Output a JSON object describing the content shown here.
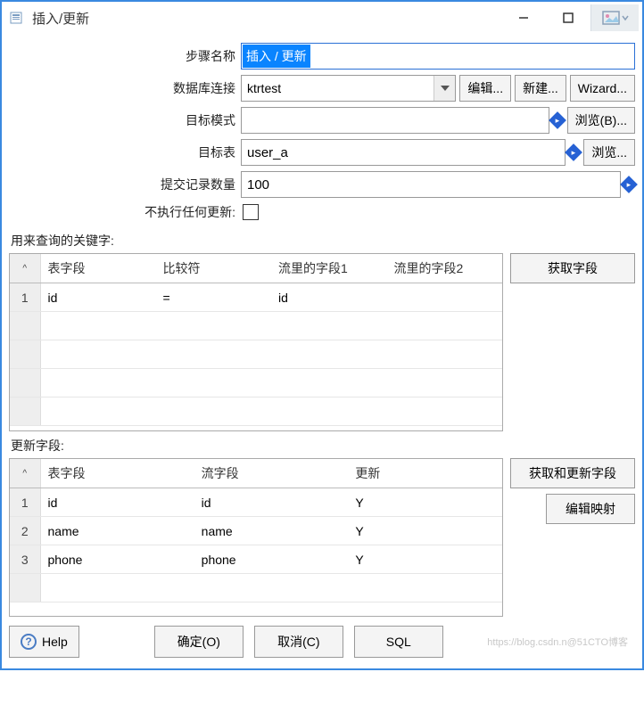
{
  "window": {
    "title": "插入/更新"
  },
  "form": {
    "step_name_label": "步骤名称",
    "step_name_value": "插入 / 更新",
    "db_conn_label": "数据库连接",
    "db_conn_value": "ktrtest",
    "edit_btn": "编辑...",
    "new_btn": "新建...",
    "wizard_btn": "Wizard...",
    "target_schema_label": "目标模式",
    "target_schema_value": "",
    "browse_b_btn": "浏览(B)...",
    "target_table_label": "目标表",
    "target_table_value": "user_a",
    "browse_btn": "浏览...",
    "commit_count_label": "提交记录数量",
    "commit_count_value": "100",
    "no_update_label": "不执行任何更新:"
  },
  "lookup": {
    "section_label": "用来查询的关键字:",
    "get_fields_btn": "获取字段",
    "headers": {
      "num": "#",
      "table_field": "表字段",
      "comparator": "比较符",
      "stream_field1": "流里的字段1",
      "stream_field2": "流里的字段2"
    },
    "rows": [
      {
        "num": "1",
        "table_field": "id",
        "comparator": "=",
        "stream_field1": "id",
        "stream_field2": ""
      }
    ]
  },
  "update": {
    "section_label": "更新字段:",
    "get_update_btn": "获取和更新字段",
    "edit_mapping_btn": "编辑映射",
    "headers": {
      "num": "#",
      "table_field": "表字段",
      "stream_field": "流字段",
      "update": "更新"
    },
    "rows": [
      {
        "num": "1",
        "table_field": "id",
        "stream_field": "id",
        "update": "Y"
      },
      {
        "num": "2",
        "table_field": "name",
        "stream_field": "name",
        "update": "Y"
      },
      {
        "num": "3",
        "table_field": "phone",
        "stream_field": "phone",
        "update": "Y"
      }
    ]
  },
  "footer": {
    "help": "Help",
    "ok": "确定(O)",
    "cancel": "取消(C)",
    "sql": "SQL",
    "watermark": "https://blog.csdn.n@51CTO博客"
  }
}
